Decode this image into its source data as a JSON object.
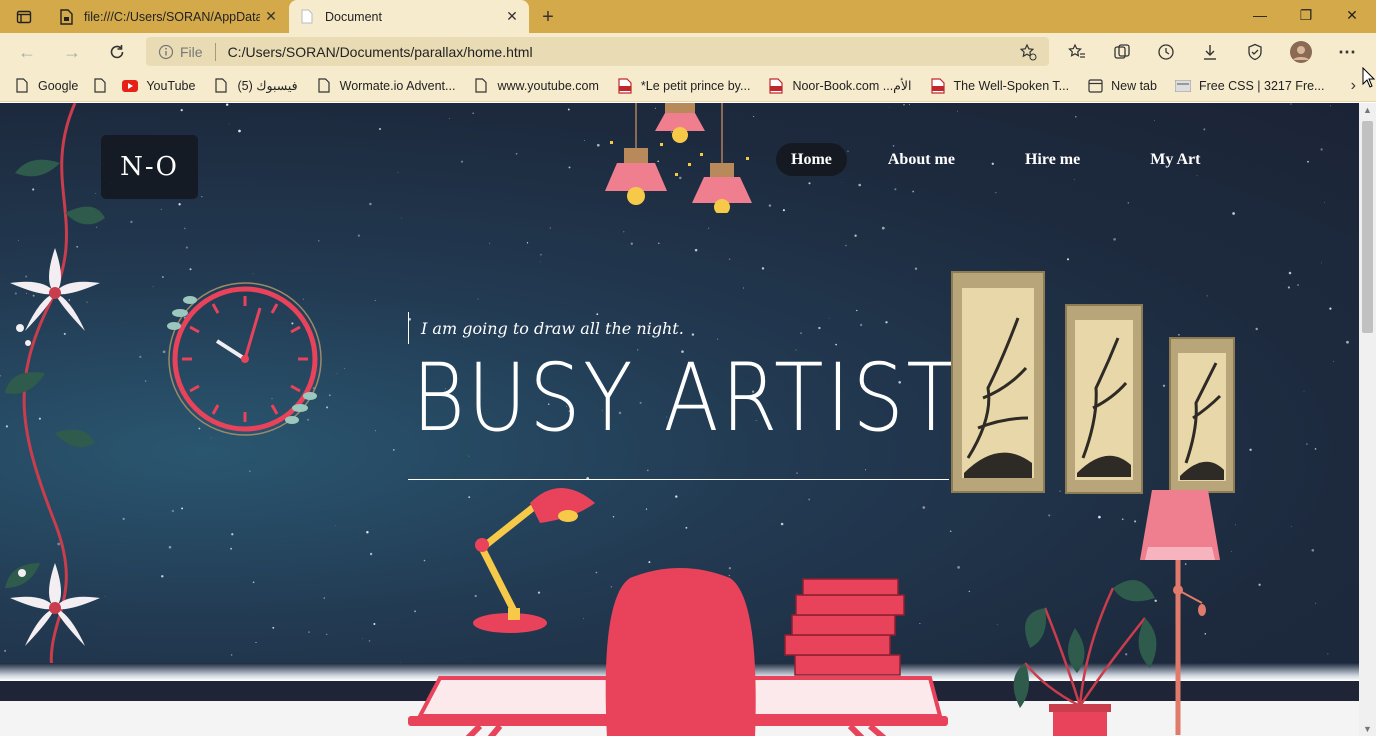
{
  "browser": {
    "tabs": [
      {
        "title": "file:///C:/Users/SORAN/AppData",
        "active": false
      },
      {
        "title": "Document",
        "active": true
      }
    ],
    "address": {
      "scheme_label": "File",
      "url": "C:/Users/SORAN/Documents/parallax/home.html"
    },
    "bookmarks": [
      {
        "label": "Google",
        "icon": "page-icon"
      },
      {
        "label": "",
        "icon": "page-icon"
      },
      {
        "label": "YouTube",
        "icon": "youtube-icon"
      },
      {
        "label": "فيسبوك (5)",
        "icon": "page-icon"
      },
      {
        "label": "Wormate.io Advent...",
        "icon": "page-icon"
      },
      {
        "label": "www.youtube.com",
        "icon": "page-icon"
      },
      {
        "label": "*Le petit prince by...",
        "icon": "pdf-icon"
      },
      {
        "label": "Noor-Book.com ...الأم",
        "icon": "pdf-icon"
      },
      {
        "label": "The Well-Spoken T...",
        "icon": "pdf-icon"
      },
      {
        "label": "New tab",
        "icon": "newtab-icon"
      },
      {
        "label": "Free CSS | 3217 Fre...",
        "icon": "css-icon"
      }
    ]
  },
  "site": {
    "logo": "N-O",
    "nav": [
      "Home",
      "About me",
      "Hire me",
      "My Art"
    ],
    "tagline": "I am going to draw all the night.",
    "title": "BUSY ARTIST"
  },
  "colors": {
    "accent_red": "#e8435a",
    "lamp_pink": "#ef7f8f",
    "tab_bar": "#d4a94a",
    "toolbar": "#f6eccd"
  }
}
